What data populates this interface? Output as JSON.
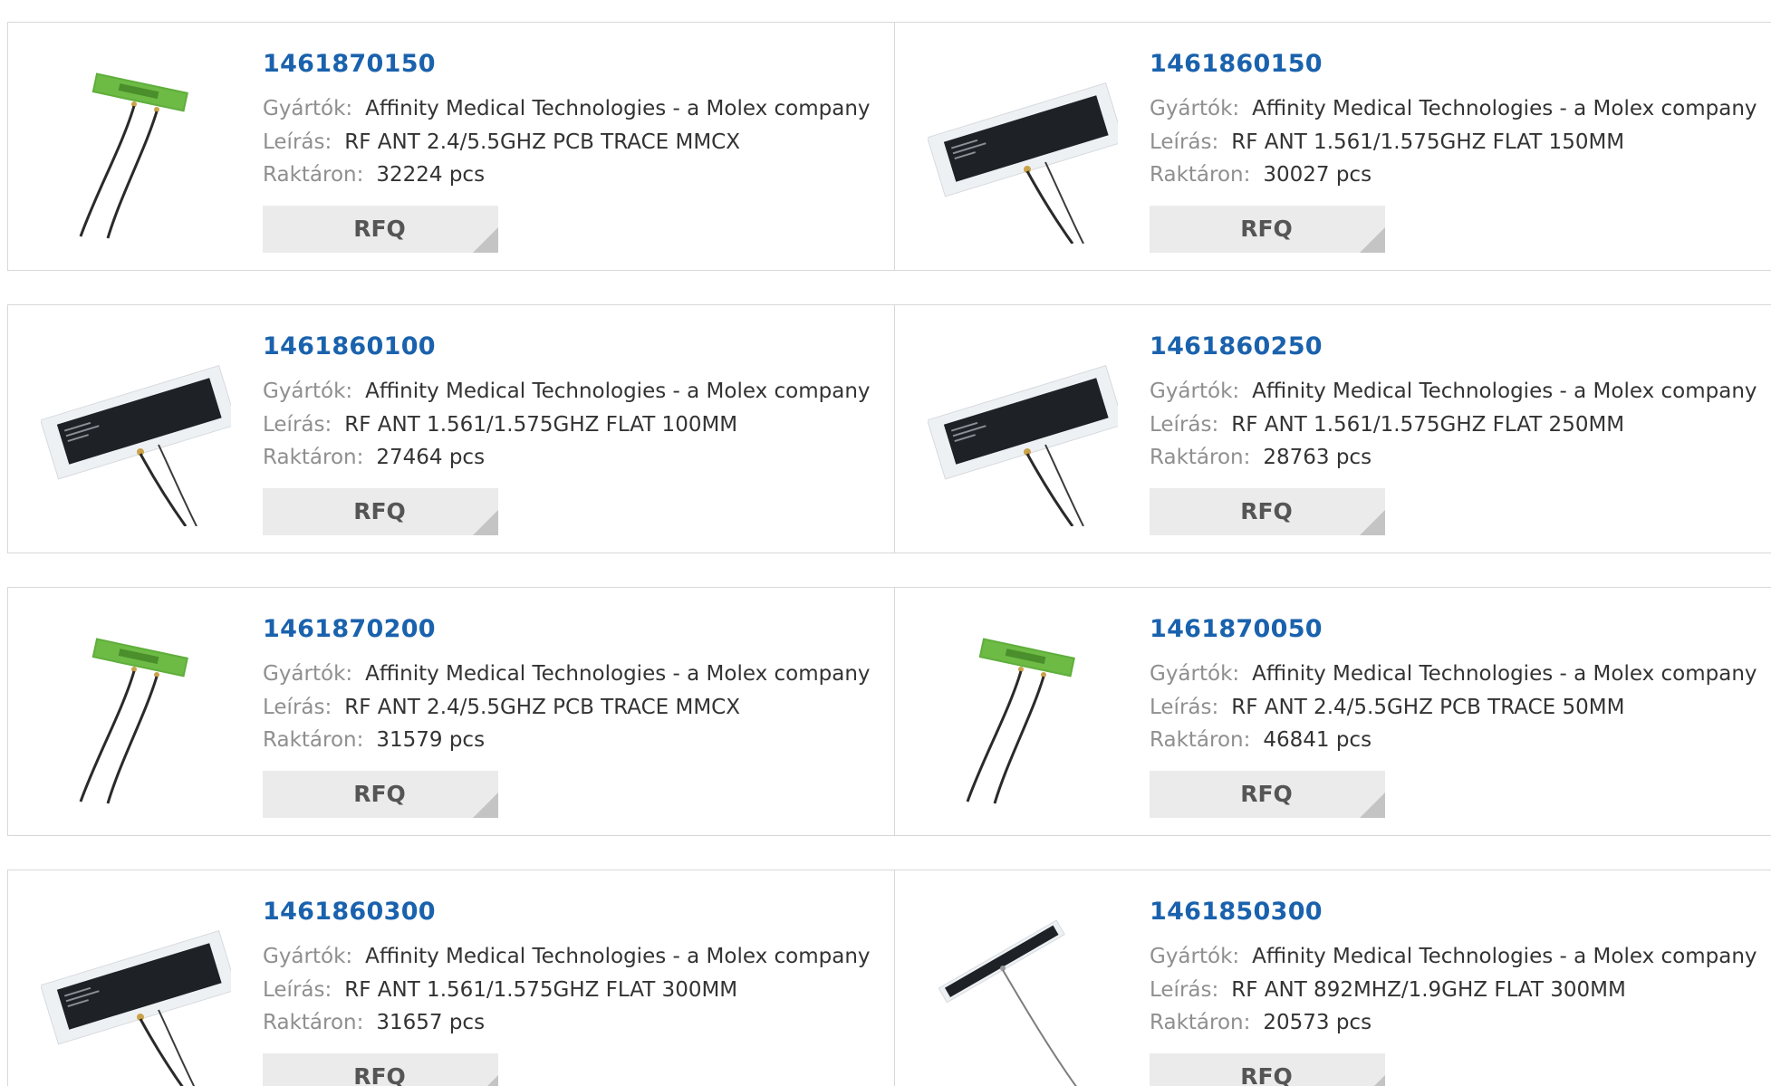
{
  "products": [
    {
      "part_number": "1461870150",
      "manufacturer_label": "Gyártók:",
      "manufacturer": "Affinity Medical Technologies - a Molex company",
      "description_label": "Leírás:",
      "description": "RF ANT 2.4/5.5GHZ PCB TRACE MMCX",
      "stock_label": "Raktáron:",
      "stock": "32224 pcs",
      "rfq_label": "RFQ",
      "image_type": "green-pcb-antenna"
    },
    {
      "part_number": "1461860150",
      "manufacturer_label": "Gyártók:",
      "manufacturer": "Affinity Medical Technologies - a Molex company",
      "description_label": "Leírás:",
      "description": "RF ANT 1.561/1.575GHZ FLAT 150MM",
      "stock_label": "Raktáron:",
      "stock": "30027 pcs",
      "rfq_label": "RFQ",
      "image_type": "flat-black-antenna"
    },
    {
      "part_number": "1461860100",
      "manufacturer_label": "Gyártók:",
      "manufacturer": "Affinity Medical Technologies - a Molex company",
      "description_label": "Leírás:",
      "description": "RF ANT 1.561/1.575GHZ FLAT 100MM",
      "stock_label": "Raktáron:",
      "stock": "27464 pcs",
      "rfq_label": "RFQ",
      "image_type": "flat-black-antenna"
    },
    {
      "part_number": "1461860250",
      "manufacturer_label": "Gyártók:",
      "manufacturer": "Affinity Medical Technologies - a Molex company",
      "description_label": "Leírás:",
      "description": "RF ANT 1.561/1.575GHZ FLAT 250MM",
      "stock_label": "Raktáron:",
      "stock": "28763 pcs",
      "rfq_label": "RFQ",
      "image_type": "flat-black-antenna"
    },
    {
      "part_number": "1461870200",
      "manufacturer_label": "Gyártók:",
      "manufacturer": "Affinity Medical Technologies - a Molex company",
      "description_label": "Leírás:",
      "description": "RF ANT 2.4/5.5GHZ PCB TRACE MMCX",
      "stock_label": "Raktáron:",
      "stock": "31579 pcs",
      "rfq_label": "RFQ",
      "image_type": "green-pcb-antenna"
    },
    {
      "part_number": "1461870050",
      "manufacturer_label": "Gyártók:",
      "manufacturer": "Affinity Medical Technologies - a Molex company",
      "description_label": "Leírás:",
      "description": "RF ANT 2.4/5.5GHZ PCB TRACE 50MM",
      "stock_label": "Raktáron:",
      "stock": "46841 pcs",
      "rfq_label": "RFQ",
      "image_type": "green-pcb-antenna"
    },
    {
      "part_number": "1461860300",
      "manufacturer_label": "Gyártók:",
      "manufacturer": "Affinity Medical Technologies - a Molex company",
      "description_label": "Leírás:",
      "description": "RF ANT 1.561/1.575GHZ FLAT 300MM",
      "stock_label": "Raktáron:",
      "stock": "31657 pcs",
      "rfq_label": "RFQ",
      "image_type": "flat-black-antenna"
    },
    {
      "part_number": "1461850300",
      "manufacturer_label": "Gyártók:",
      "manufacturer": "Affinity Medical Technologies - a Molex company",
      "description_label": "Leírás:",
      "description": "RF ANT 892MHZ/1.9GHZ FLAT 300MM",
      "stock_label": "Raktáron:",
      "stock": "20573 pcs",
      "rfq_label": "RFQ",
      "image_type": "narrow-flat-antenna"
    }
  ],
  "colors": {
    "part_link": "#1a62ad",
    "label": "#8f8f8f",
    "value": "#333333",
    "rfq_bg": "#ebebeb",
    "border": "#d8d8d8"
  }
}
